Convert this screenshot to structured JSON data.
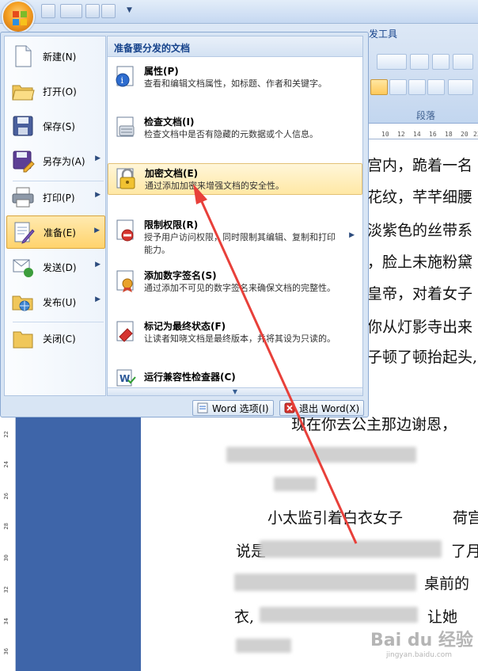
{
  "ribbon": {
    "tab_label": "发工具",
    "group_label": "段落"
  },
  "ruler_top": [
    "10",
    "12",
    "14",
    "16",
    "18",
    "20",
    "22"
  ],
  "ruler_left": [
    "22",
    "24",
    "26",
    "28",
    "30",
    "32",
    "34",
    "36"
  ],
  "document": {
    "lines": [
      "宫内，跪着一名",
      "花纹，芊芊细腰",
      "淡紫色的丝带系",
      "，脸上未施粉黛",
      "皇帝，对着女子",
      "你从灯影寺出来",
      "子顿了顿抬起头,",
      "现在你去公主那边谢恩，",
      "小太监引着白衣女子",
      "荷宫",
      "说是",
      "了月",
      "桌前的",
      "衣,",
      "让她"
    ]
  },
  "office_menu": {
    "left_items": [
      {
        "label": "新建(N)",
        "icon": "new-document-icon",
        "has_submenu": false
      },
      {
        "label": "打开(O)",
        "icon": "open-folder-icon",
        "has_submenu": false
      },
      {
        "label": "保存(S)",
        "icon": "save-disk-icon",
        "has_submenu": false
      },
      {
        "label": "另存为(A)",
        "icon": "save-as-icon",
        "has_submenu": true
      },
      {
        "label": "打印(P)",
        "icon": "printer-icon",
        "has_submenu": true
      },
      {
        "label": "准备(E)",
        "icon": "prepare-icon",
        "has_submenu": true,
        "selected": true
      },
      {
        "label": "发送(D)",
        "icon": "send-icon",
        "has_submenu": true
      },
      {
        "label": "发布(U)",
        "icon": "publish-icon",
        "has_submenu": true
      },
      {
        "label": "关闭(C)",
        "icon": "close-folder-icon",
        "has_submenu": false
      }
    ],
    "right_header": "准备要分发的文档",
    "right_items": [
      {
        "title": "属性(P)",
        "desc": "查看和编辑文档属性，如标题、作者和关键字。",
        "icon": "properties-icon"
      },
      {
        "title": "检查文档(I)",
        "desc": "检查文档中是否有隐藏的元数据或个人信息。",
        "icon": "inspect-document-icon"
      },
      {
        "title": "加密文档(E)",
        "desc": "通过添加加密来增强文档的安全性。",
        "icon": "encrypt-lock-icon",
        "highlighted": true
      },
      {
        "title": "限制权限(R)",
        "desc": "授予用户访问权限，同时限制其编辑、复制和打印能力。",
        "icon": "restrict-permission-icon",
        "has_submenu": true
      },
      {
        "title": "添加数字签名(S)",
        "desc": "通过添加不可见的数字签名来确保文档的完整性。",
        "icon": "digital-signature-icon"
      },
      {
        "title": "标记为最终状态(F)",
        "desc": "让读者知晓文档是最终版本，并将其设为只读的。",
        "icon": "mark-final-icon"
      },
      {
        "title": "运行兼容性检查器(C)",
        "desc": "",
        "icon": "compatibility-checker-icon"
      }
    ],
    "options_button": "Word 选项(I)",
    "exit_button": "退出 Word(X)"
  },
  "watermark": {
    "text": "Bai du 经验",
    "url": "jingyan.baidu.com"
  },
  "colors": {
    "annotation_arrow": "#e8403a",
    "selected_item": "#ffd36c",
    "doc_background": "#3e65a9"
  }
}
